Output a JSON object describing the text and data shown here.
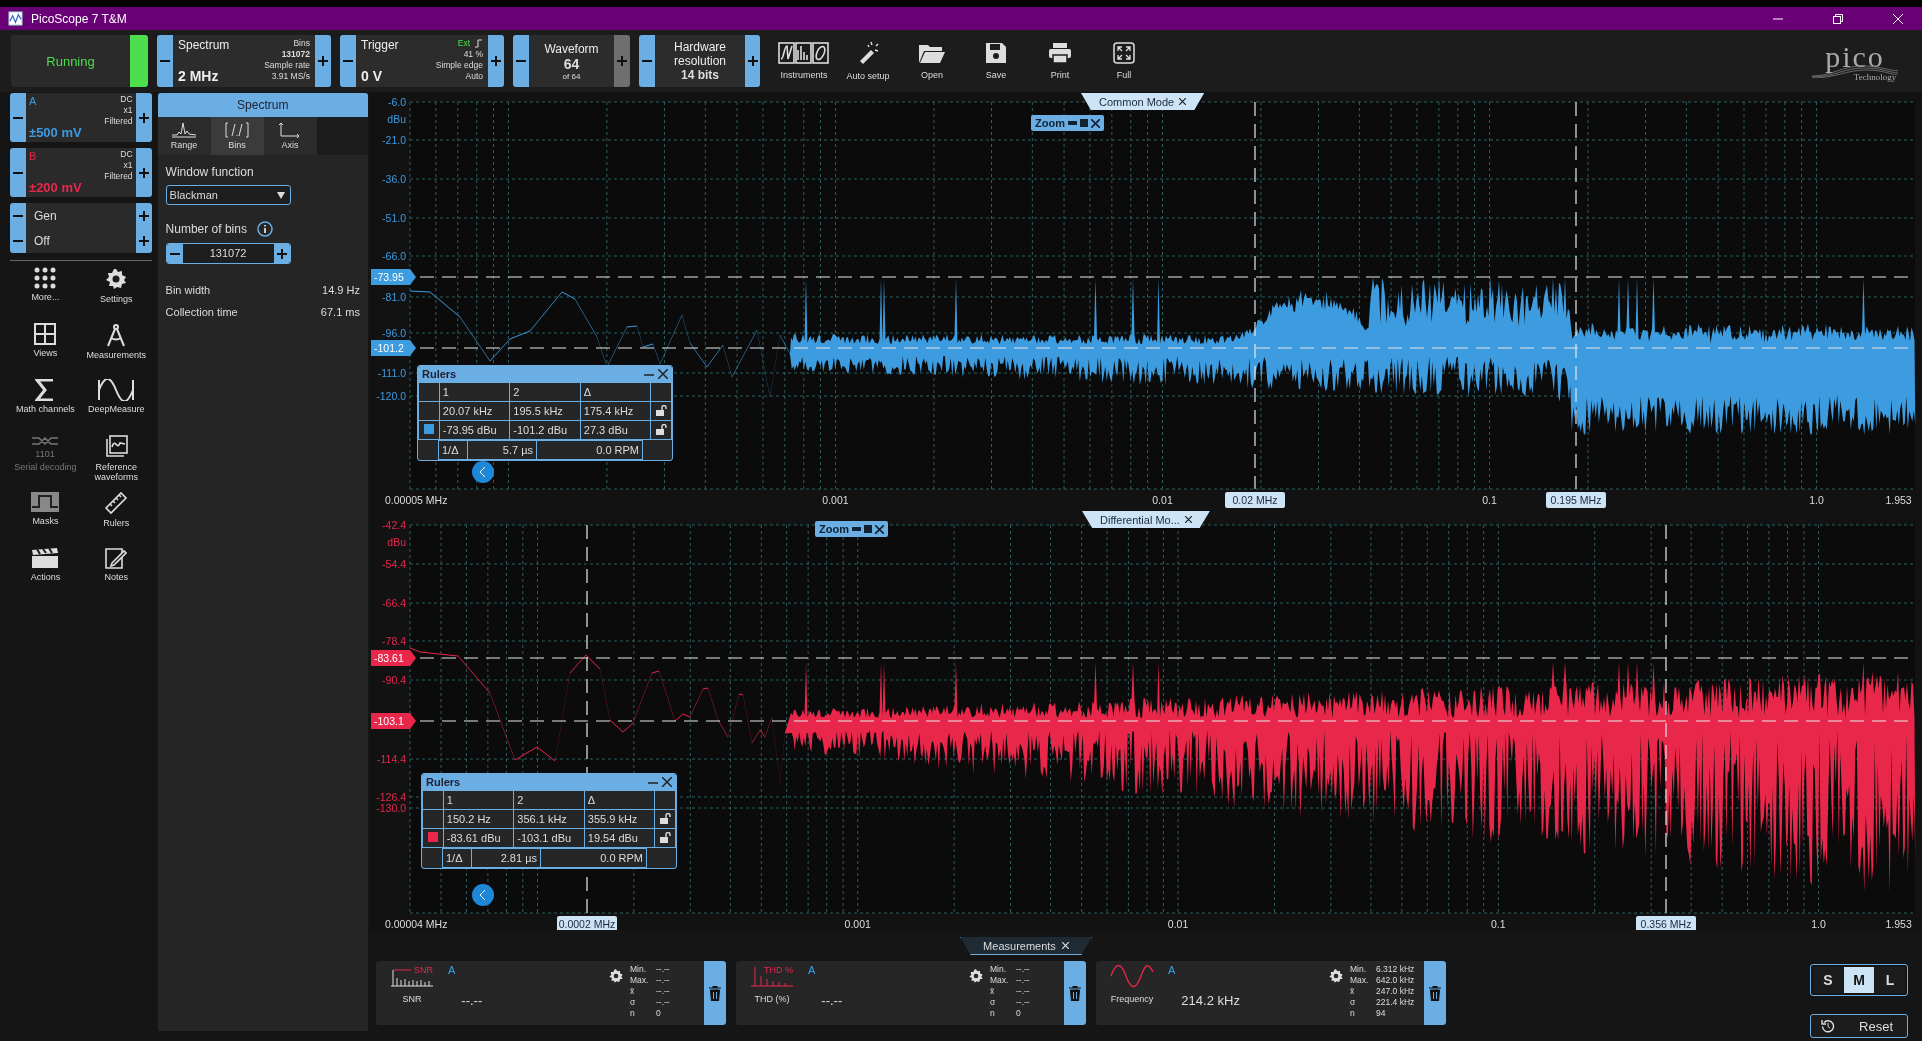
{
  "window": {
    "title": "PicoScope 7 T&M"
  },
  "toolbar": {
    "run_button": {
      "label": "Running",
      "on": true
    },
    "spectrum": {
      "title": "Spectrum",
      "value": "2 MHz",
      "bins_label": "Bins",
      "bins": "131072",
      "rate_label": "Sample rate",
      "rate": "3.91 MS/s"
    },
    "trigger": {
      "title": "Trigger",
      "value": "0 V",
      "source": "Ext",
      "level": "41 %",
      "type": "Simple edge",
      "mode": "Auto"
    },
    "waveform": {
      "title": "Waveform",
      "value": "64",
      "of": "of 64",
      "plus_disabled": true
    },
    "resolution": {
      "title": "Hardware resolution",
      "value": "14 bits"
    },
    "buttons": [
      {
        "label": "Instruments",
        "kind": "instruments"
      },
      {
        "label": "Auto setup",
        "kind": "autosetup"
      },
      {
        "label": "Open",
        "kind": "open"
      },
      {
        "label": "Save",
        "kind": "save"
      },
      {
        "label": "Print",
        "kind": "print"
      },
      {
        "label": "Full",
        "kind": "full"
      }
    ],
    "logo": {
      "name": "pico",
      "tagline": "Technology"
    }
  },
  "channels": [
    {
      "name": "A",
      "coupling": "DC",
      "probe": "x1",
      "filter": "Filtered",
      "range": "±500 mV",
      "color": "#3d9be0"
    },
    {
      "name": "B",
      "coupling": "DC",
      "probe": "x1",
      "filter": "Filtered",
      "range": "±200 mV",
      "color": "#e8274b"
    }
  ],
  "generator": [
    {
      "label": "Gen"
    },
    {
      "label": "Off"
    }
  ],
  "tools": [
    {
      "label": "More...",
      "kind": "more",
      "disabled": false
    },
    {
      "label": "Settings",
      "kind": "settings",
      "disabled": false
    },
    {
      "label": "Views",
      "kind": "views",
      "disabled": false
    },
    {
      "label": "Measurements",
      "kind": "measurements",
      "disabled": false
    },
    {
      "label": "Math channels",
      "kind": "math",
      "disabled": false
    },
    {
      "label": "DeepMeasure",
      "kind": "deepmeasure",
      "disabled": false
    },
    {
      "label": "Serial decoding",
      "kind": "serial",
      "disabled": true,
      "icon_text": "1101"
    },
    {
      "label": "Reference waveforms",
      "kind": "reference",
      "disabled": false
    },
    {
      "label": "Masks",
      "kind": "masks",
      "disabled": false
    },
    {
      "label": "Rulers",
      "kind": "rulers",
      "disabled": false
    },
    {
      "label": "Actions",
      "kind": "actions",
      "disabled": false
    },
    {
      "label": "Notes",
      "kind": "notes",
      "disabled": false
    }
  ],
  "settings_panel": {
    "title": "Spectrum",
    "tabs": [
      {
        "label": "Range",
        "kind": "range",
        "selected": false
      },
      {
        "label": "Bins",
        "kind": "bins",
        "selected": true
      },
      {
        "label": "Axis",
        "kind": "axis",
        "selected": false
      }
    ],
    "window_function": {
      "label": "Window function",
      "value": "Blackman"
    },
    "number_of_bins": {
      "label": "Number of bins",
      "value": "131072"
    },
    "stats": [
      {
        "label": "Bin width",
        "value": "14.9 Hz"
      },
      {
        "label": "Collection time",
        "value": "67.1 ms"
      }
    ]
  },
  "views": [
    {
      "title": "Common Mode",
      "zoom_label": "Zoom",
      "unit": "dBu",
      "color": "#3d9be0",
      "y_axis_labels": [
        "-6.0",
        "-21.0",
        "-36.0",
        "-51.0",
        "-66.0",
        "-81.0",
        "-96.0",
        "-111.0",
        "-120.0"
      ],
      "x_axis_labels": [
        "0.00005 MHz",
        "0.001",
        "0.01",
        "0.1",
        "1.0",
        "1.953"
      ],
      "h_rulers": [
        "-73.95",
        "-101.2"
      ],
      "v_rulers": [
        "0.02 MHz",
        "0.195 MHz"
      ],
      "rulers": {
        "title": "Rulers",
        "header": [
          "1",
          "2",
          "Δ"
        ],
        "rows": [
          [
            "20.07 kHz",
            "195.5 kHz",
            "175.4 kHz"
          ],
          [
            "-73.95 dBu",
            "-101.2 dBu",
            "27.3 dBu"
          ]
        ],
        "inverse": [
          "1/Δ",
          "5.7 µs",
          "0.0 RPM"
        ]
      }
    },
    {
      "title": "Differential Mo...",
      "zoom_label": "Zoom",
      "unit": "dBu",
      "color": "#e8274b",
      "y_axis_labels": [
        "-42.4",
        "-54.4",
        "-66.4",
        "-78.4",
        "-90.4",
        "-114.4",
        "-126.4",
        "-130.0"
      ],
      "x_axis_labels": [
        "0.00004 MHz",
        "0.001",
        "0.01",
        "0.1",
        "1.0",
        "1.953"
      ],
      "h_rulers": [
        "-83.61",
        "-103.1"
      ],
      "v_rulers": [
        "0.0002 MHz",
        "0.356 MHz"
      ],
      "rulers": {
        "title": "Rulers",
        "header": [
          "1",
          "2",
          "Δ"
        ],
        "rows": [
          [
            "150.2 Hz",
            "356.1 kHz",
            "355.9 kHz"
          ],
          [
            "-83.61 dBu",
            "-103.1 dBu",
            "19.54 dBu"
          ]
        ],
        "inverse": [
          "1/Δ",
          "2.81 µs",
          "0.0 RPM"
        ]
      }
    }
  ],
  "measurements_tab": "Measurements",
  "measurements": [
    {
      "kind": "snr",
      "icon_text": "SNR",
      "channel": "A",
      "label": "SNR",
      "value": "--.--",
      "stats": [
        [
          "Min.",
          "--.--"
        ],
        [
          "Max.",
          "--.--"
        ],
        [
          "x̄",
          "--.--"
        ],
        [
          "σ",
          "--.--"
        ],
        [
          "n",
          "0"
        ]
      ]
    },
    {
      "kind": "thd",
      "icon_text": "THD %",
      "channel": "A",
      "label": "THD (%)",
      "value": "--.--",
      "stats": [
        [
          "Min.",
          "--.--"
        ],
        [
          "Max.",
          "--.--"
        ],
        [
          "x̄",
          "--.--"
        ],
        [
          "σ",
          "--.--"
        ],
        [
          "n",
          "0"
        ]
      ]
    },
    {
      "kind": "frequency",
      "channel": "A",
      "label": "Frequency",
      "value": "214.2 kHz",
      "stats": [
        [
          "Min.",
          "6.312 kHz"
        ],
        [
          "Max.",
          "642.0 kHz"
        ],
        [
          "x̄",
          "247.0 kHz"
        ],
        [
          "σ",
          "221.4 kHz"
        ],
        [
          "n",
          "94"
        ]
      ]
    }
  ],
  "sizes": [
    {
      "label": "S",
      "selected": false
    },
    {
      "label": "M",
      "selected": true
    },
    {
      "label": "L",
      "selected": false
    }
  ],
  "reset_button": "Reset"
}
